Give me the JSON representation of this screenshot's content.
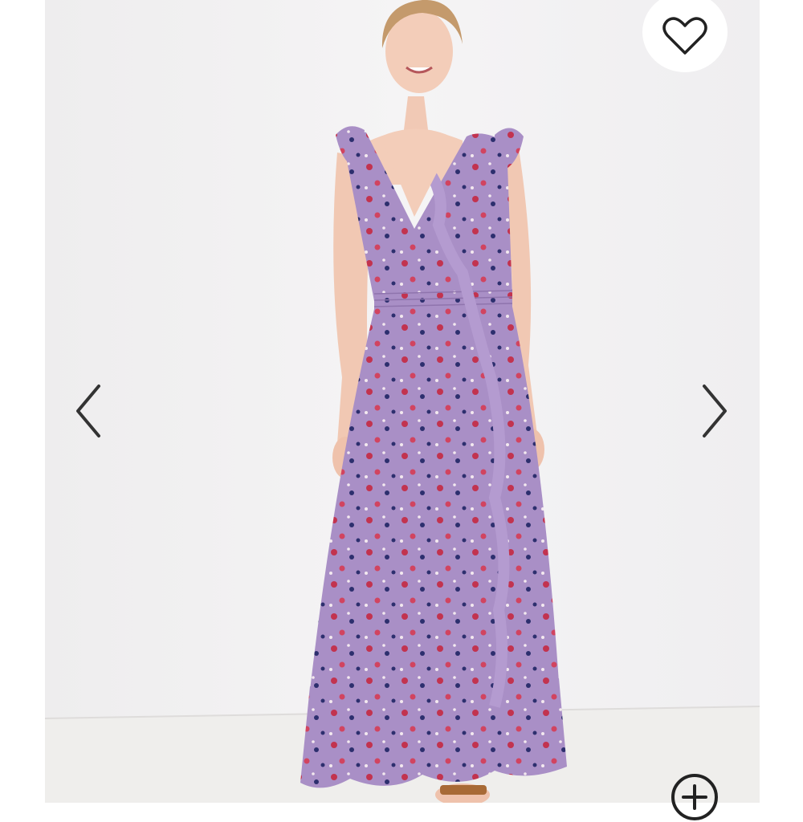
{
  "gallery": {
    "image_alt": "",
    "icons": {
      "favorite": "heart-icon",
      "previous": "chevron-left-icon",
      "next": "chevron-right-icon",
      "zoom": "zoom-in-icon"
    }
  },
  "colors": {
    "background": "#ffffff",
    "wall": "#f1f0f1",
    "floor": "#efeeec",
    "dress": "#a98fc6",
    "icon": "#222222"
  }
}
